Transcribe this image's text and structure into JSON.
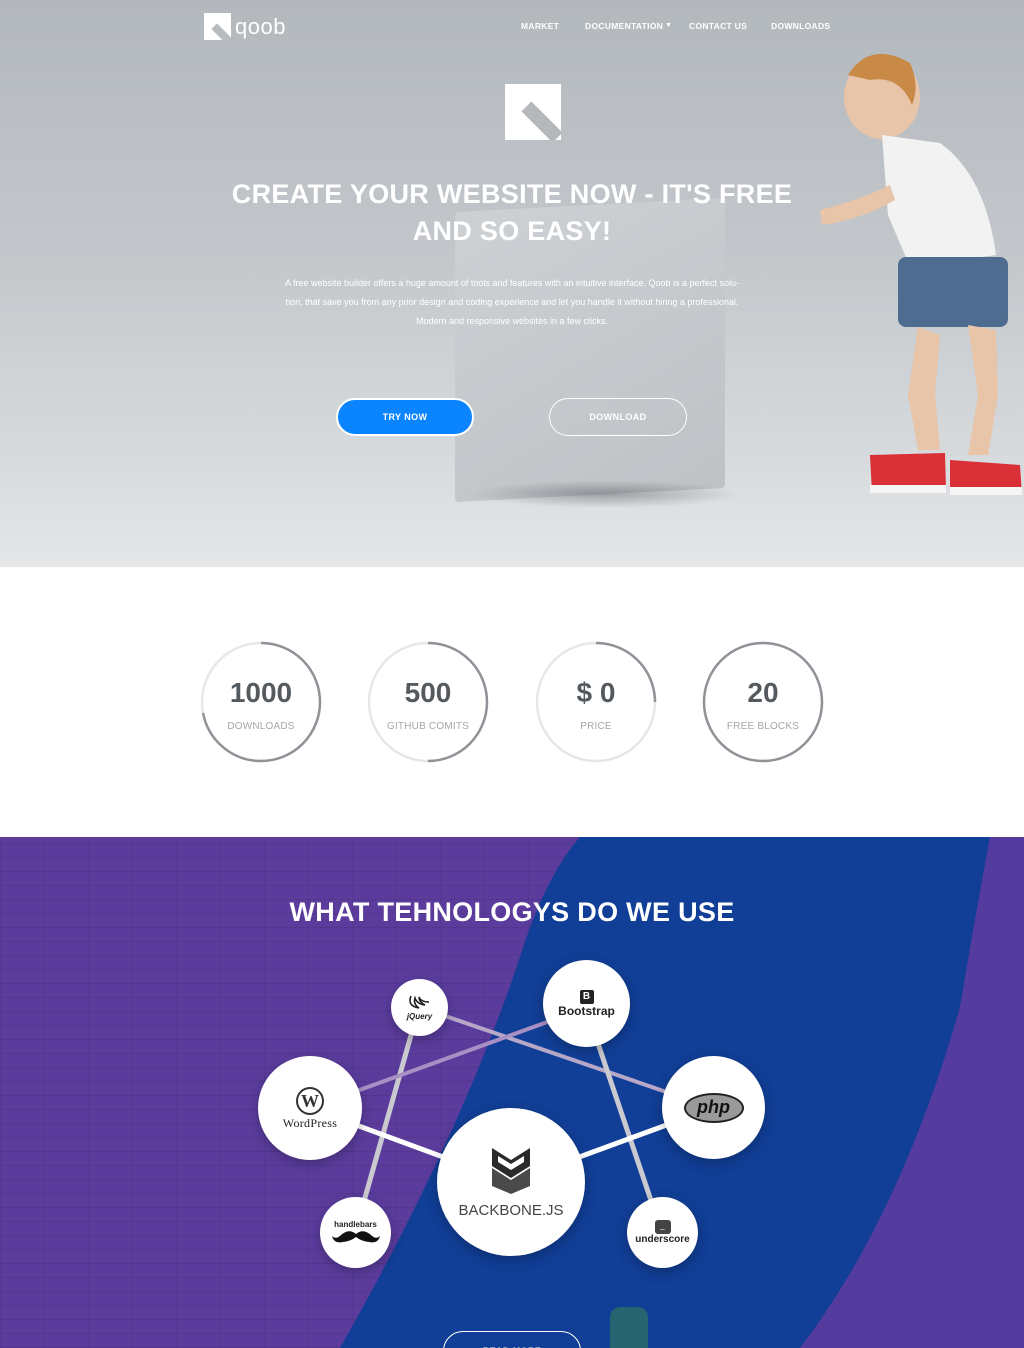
{
  "logo": {
    "text": "qoob"
  },
  "nav": {
    "items": [
      {
        "label": "MARKET"
      },
      {
        "label": "DOCUMENTATION"
      },
      {
        "label": "CONTACT US"
      },
      {
        "label": "DOWNLOADS"
      }
    ]
  },
  "hero": {
    "title": "CREATE YOUR WEBSITE NOW - IT'S FREE AND SO EASY!",
    "description_lines": [
      "A free website builder offers a huge amount of tools and features with an intuitive interface. Qoob is a perfect solu-",
      "tion, that save you from any prior design and coding experience and let you handle it without hiring a professional.",
      "Modern and responsive websites in a few clicks."
    ],
    "primary_button": "TRY NOW",
    "secondary_button": "DOWNLOAD"
  },
  "stats": [
    {
      "value": "1000",
      "label": "DOWNLOADS",
      "progress": 0.72
    },
    {
      "value": "500",
      "label": "GITHUB COMITS",
      "progress": 0.5
    },
    {
      "value": "$ 0",
      "label": "PRICE",
      "progress": 0.25
    },
    {
      "value": "20",
      "label": "FREE BLOCKS",
      "progress": 1.0
    }
  ],
  "tech": {
    "title": "WHAT TEHNOLOGYS DO WE USE",
    "nodes": [
      {
        "label": "jQuery",
        "icon": "jquery-icon"
      },
      {
        "label": "Bootstrap",
        "icon": "bootstrap-icon"
      },
      {
        "label": "WordPress",
        "icon": "wordpress-icon"
      },
      {
        "label": "php",
        "icon": "php-icon"
      },
      {
        "label": "BACKBONE.JS",
        "icon": "backbone-icon"
      },
      {
        "label": "handlebars",
        "icon": "mustache-icon"
      },
      {
        "label": "underscore",
        "icon": "underscore-icon"
      }
    ],
    "read_more": "READ MORE"
  },
  "colors": {
    "accent": "#0a84ff",
    "tech_purple": "#5b3c9d",
    "tech_blue": "#0b3f96",
    "stat_text": "#555a5f",
    "stat_ring": "#8f9398"
  }
}
